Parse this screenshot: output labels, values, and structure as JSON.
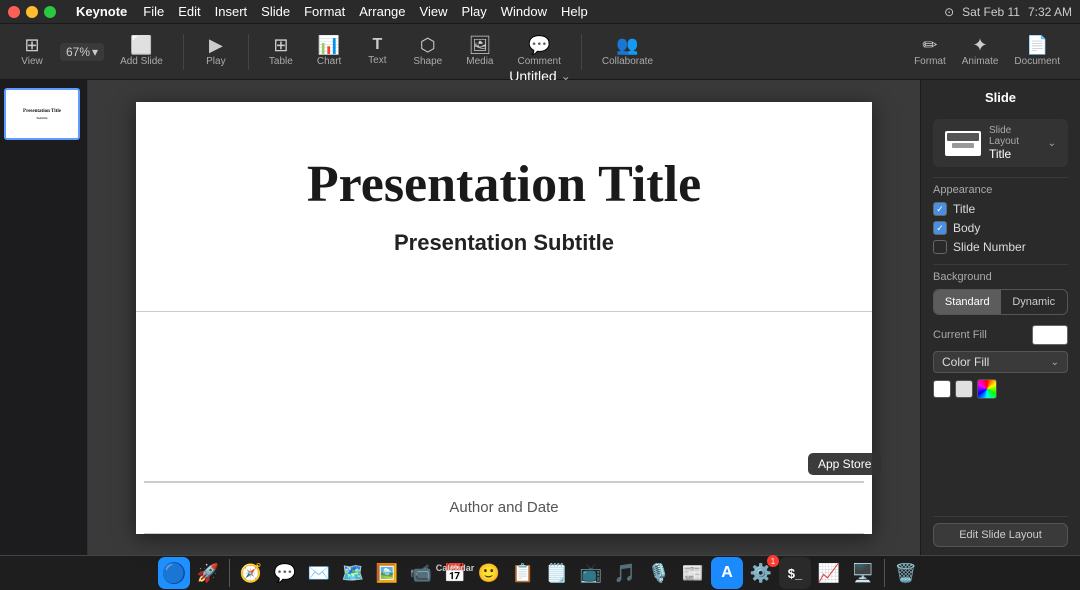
{
  "menubar": {
    "app_name": "Keynote",
    "menus": [
      "File",
      "Edit",
      "Insert",
      "Slide",
      "Format",
      "Arrange",
      "View",
      "Play",
      "Window",
      "Help"
    ],
    "right": {
      "time": "7:32 AM",
      "date": "Sat Feb 11"
    },
    "title": "Untitled"
  },
  "toolbar": {
    "zoom_value": "67%",
    "items": [
      {
        "label": "View",
        "icon": "⊞"
      },
      {
        "label": "Add Slide",
        "icon": "＋"
      },
      {
        "label": "Play",
        "icon": "▶"
      },
      {
        "label": "Table",
        "icon": "⊞"
      },
      {
        "label": "Chart",
        "icon": "📊"
      },
      {
        "label": "Text",
        "icon": "T"
      },
      {
        "label": "Shape",
        "icon": "⬡"
      },
      {
        "label": "Media",
        "icon": "🖼"
      },
      {
        "label": "Comment",
        "icon": "💬"
      },
      {
        "label": "Collaborate",
        "icon": "👥"
      },
      {
        "label": "Format",
        "icon": "✏️"
      },
      {
        "label": "Animate",
        "icon": "✦"
      },
      {
        "label": "Document",
        "icon": "📄"
      }
    ]
  },
  "slide": {
    "title": "Presentation Title",
    "subtitle": "Presentation Subtitle",
    "author": "Author and Date"
  },
  "format_panel": {
    "tabs": [
      "Format",
      "Animate",
      "Document"
    ],
    "active_tab": "Format",
    "section_title": "Slide",
    "slide_layout": {
      "label": "Slide Layout",
      "value": "Title"
    },
    "appearance": {
      "label": "Appearance",
      "items": [
        {
          "label": "Title",
          "checked": true
        },
        {
          "label": "Body",
          "checked": true
        },
        {
          "label": "Slide Number",
          "checked": false
        }
      ]
    },
    "background": {
      "label": "Background",
      "options": [
        "Standard",
        "Dynamic"
      ],
      "active": "Standard"
    },
    "current_fill": {
      "label": "Current Fill"
    },
    "fill_type": {
      "label": "Color Fill"
    },
    "colors": [
      "#ffffff",
      "#e8e8e8"
    ],
    "edit_layout_btn": "Edit Slide Layout"
  },
  "tooltip": {
    "text": "App Store"
  },
  "dock": {
    "items": [
      {
        "name": "finder",
        "icon": "🔵",
        "label": "Finder"
      },
      {
        "name": "launchpad",
        "icon": "🚀",
        "label": "Launchpad"
      },
      {
        "name": "safari",
        "icon": "🧭",
        "label": "Safari"
      },
      {
        "name": "messages",
        "icon": "💬",
        "label": "Messages"
      },
      {
        "name": "mail",
        "icon": "✉️",
        "label": "Mail"
      },
      {
        "name": "maps",
        "icon": "🗺️",
        "label": "Maps"
      },
      {
        "name": "photos",
        "icon": "🖼️",
        "label": "Photos"
      },
      {
        "name": "facetime",
        "icon": "📹",
        "label": "FaceTime"
      },
      {
        "name": "calendar",
        "icon": "📅",
        "label": "Calendar"
      },
      {
        "name": "contacts",
        "icon": "🙂",
        "label": "Contacts"
      },
      {
        "name": "reminders",
        "icon": "📋",
        "label": "Reminders"
      },
      {
        "name": "notes",
        "icon": "🗒️",
        "label": "Notes"
      },
      {
        "name": "appletv",
        "icon": "📺",
        "label": "Apple TV"
      },
      {
        "name": "music",
        "icon": "🎵",
        "label": "Music"
      },
      {
        "name": "podcasts",
        "icon": "🎙️",
        "label": "Podcasts"
      },
      {
        "name": "news",
        "icon": "📰",
        "label": "News"
      },
      {
        "name": "appstore",
        "icon": "🅐",
        "label": "App Store"
      },
      {
        "name": "settings",
        "icon": "⚙️",
        "label": "System Settings"
      },
      {
        "name": "terminal",
        "icon": "⬛",
        "label": "Terminal"
      },
      {
        "name": "activitymonitor",
        "icon": "📈",
        "label": "Activity Monitor"
      },
      {
        "name": "screensharing",
        "icon": "🖥️",
        "label": "Screen Sharing"
      },
      {
        "name": "trash",
        "icon": "🗑️",
        "label": "Trash"
      }
    ]
  }
}
